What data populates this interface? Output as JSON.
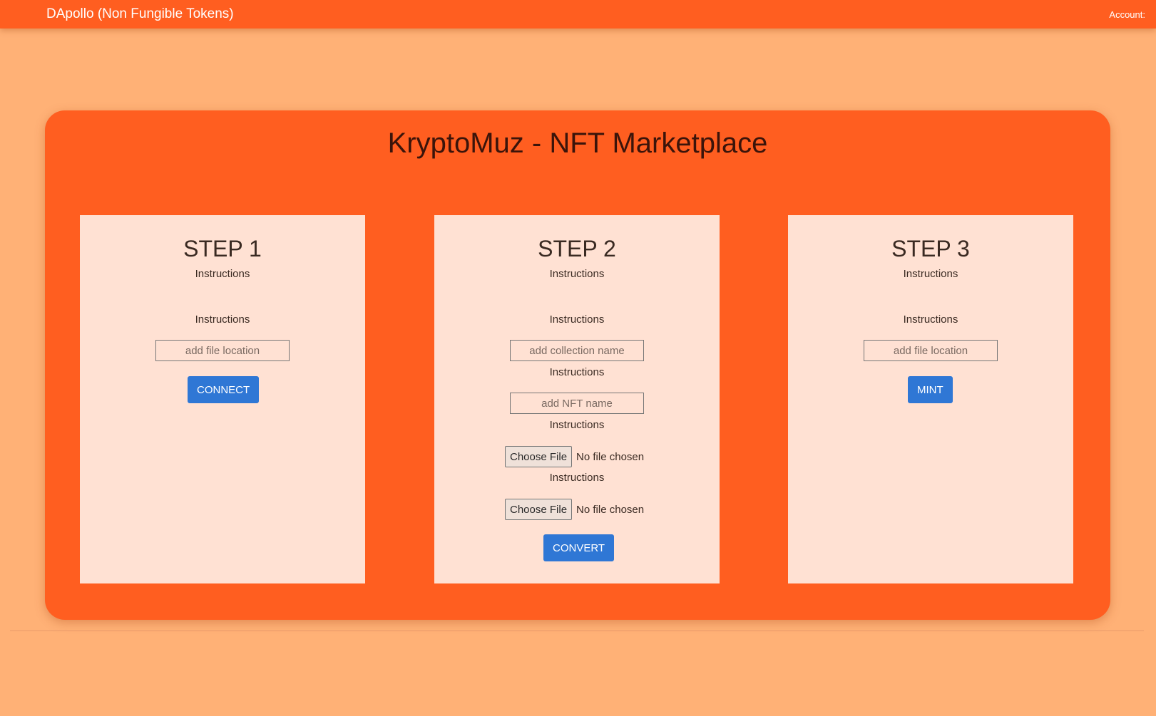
{
  "navbar": {
    "brand": "DApollo (Non Fungible Tokens)",
    "account_label": "Account:"
  },
  "hero": {
    "title": "KryptoMuz - NFT Marketplace"
  },
  "steps": [
    {
      "title": "STEP 1",
      "instructions": [
        "Instructions",
        "Instructions"
      ],
      "input_placeholder": "add file location",
      "button_label": "CONNECT"
    },
    {
      "title": "STEP 2",
      "instructions": [
        "Instructions",
        "Instructions",
        "Instructions",
        "Instructions",
        "Instructions"
      ],
      "collection_placeholder": "add collection name",
      "nft_name_placeholder": "add NFT name",
      "file_button_label": "Choose File",
      "file_status": "No file chosen",
      "button_label": "CONVERT"
    },
    {
      "title": "STEP 3",
      "instructions": [
        "Instructions",
        "Instructions"
      ],
      "input_placeholder": "add file location",
      "button_label": "MINT"
    }
  ],
  "colors": {
    "page_background": "#ffb176",
    "brand_orange": "#ff5e20",
    "card_background": "#ffe1d3",
    "button_blue": "#2f77d5"
  }
}
